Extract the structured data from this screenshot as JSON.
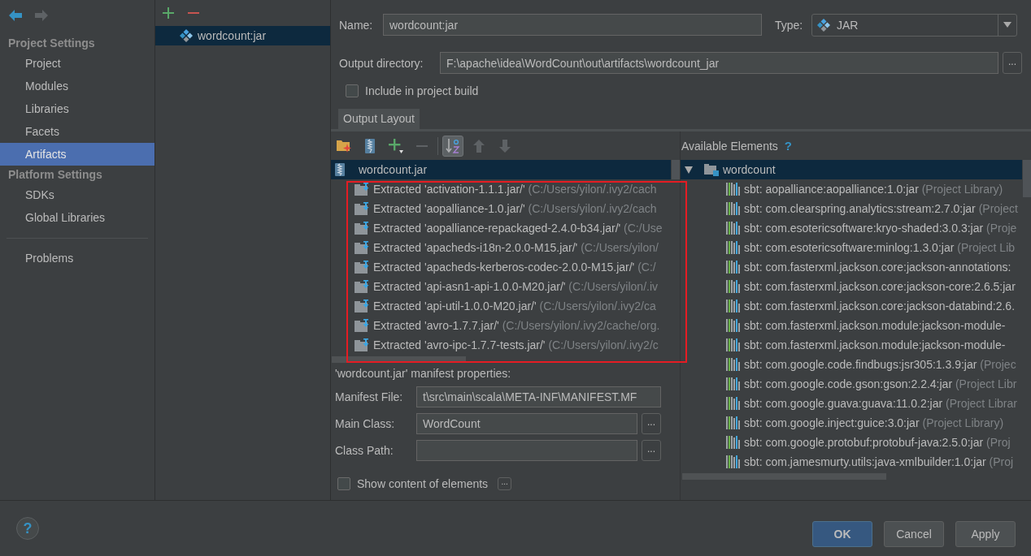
{
  "sidebar": {
    "nav": [
      {
        "kind": "back",
        "disabled": false
      },
      {
        "kind": "forward",
        "disabled": true
      }
    ],
    "sections": [
      {
        "title": "Project Settings",
        "items": [
          {
            "label": "Project",
            "selected": false
          },
          {
            "label": "Modules",
            "selected": false
          },
          {
            "label": "Libraries",
            "selected": false
          },
          {
            "label": "Facets",
            "selected": false
          },
          {
            "label": "Artifacts",
            "selected": true
          }
        ]
      },
      {
        "title": "Platform Settings",
        "items": [
          {
            "label": "SDKs",
            "selected": false
          },
          {
            "label": "Global Libraries",
            "selected": false
          }
        ]
      }
    ],
    "bottom_items": [
      {
        "label": "Problems",
        "selected": false
      }
    ]
  },
  "artifacts": {
    "toolbar": [
      {
        "kind": "add",
        "disabled": false
      },
      {
        "kind": "remove",
        "disabled": false
      }
    ],
    "items": [
      {
        "label": "wordcount:jar",
        "selected": true
      }
    ]
  },
  "form": {
    "name": {
      "label": "Name:",
      "value": "wordcount:jar"
    },
    "type": {
      "label": "Type:",
      "value": "JAR"
    },
    "output_directory": {
      "label": "Output directory:",
      "value": "F:\\apache\\idea\\WordCount\\out\\artifacts\\wordcount_jar",
      "browse": "..."
    },
    "include_in_build": {
      "label": "Include in project build",
      "checked": false
    }
  },
  "tabs": [
    {
      "label": "Output Layout",
      "selected": true
    }
  ],
  "layout_toolbar": [
    {
      "kind": "new-folder",
      "disabled": false,
      "pressed": false
    },
    {
      "kind": "archive",
      "disabled": false,
      "pressed": false
    },
    {
      "kind": "add",
      "disabled": false,
      "pressed": false
    },
    {
      "kind": "remove",
      "disabled": true,
      "pressed": false
    },
    {
      "kind": "sort",
      "disabled": false,
      "pressed": true
    },
    {
      "kind": "up",
      "disabled": true,
      "pressed": false
    },
    {
      "kind": "down",
      "disabled": true,
      "pressed": false
    }
  ],
  "output_tree": {
    "annotation_frame": true,
    "root": {
      "label": "wordcount.jar",
      "selected": true,
      "children": [
        {
          "label": "Extracted 'activation-1.1.1.jar/'",
          "hint": "(C:/Users/yilon/.ivy2/cach",
          "selected": false
        },
        {
          "label": "Extracted 'aopalliance-1.0.jar/'",
          "hint": "(C:/Users/yilon/.ivy2/cach",
          "selected": false
        },
        {
          "label": "Extracted 'aopalliance-repackaged-2.4.0-b34.jar/'",
          "hint": "(C:/Use",
          "selected": false
        },
        {
          "label": "Extracted 'apacheds-i18n-2.0.0-M15.jar/'",
          "hint": "(C:/Users/yilon/",
          "selected": false
        },
        {
          "label": "Extracted 'apacheds-kerberos-codec-2.0.0-M15.jar/'",
          "hint": "(C:/",
          "selected": false
        },
        {
          "label": "Extracted 'api-asn1-api-1.0.0-M20.jar/'",
          "hint": "(C:/Users/yilon/.iv",
          "selected": false
        },
        {
          "label": "Extracted 'api-util-1.0.0-M20.jar/'",
          "hint": "(C:/Users/yilon/.ivy2/ca",
          "selected": false
        },
        {
          "label": "Extracted 'avro-1.7.7.jar/'",
          "hint": "(C:/Users/yilon/.ivy2/cache/org.",
          "selected": false
        },
        {
          "label": "Extracted 'avro-ipc-1.7.7-tests.jar/'",
          "hint": "(C:/Users/yilon/.ivy2/c",
          "selected": false
        }
      ]
    }
  },
  "manifest": {
    "title": "'wordcount.jar' manifest properties:",
    "fields": [
      {
        "label": "Manifest File:",
        "value": "t\\src\\main\\scala\\META-INF\\MANIFEST.MF"
      },
      {
        "label": "Main Class:",
        "value": "WordCount",
        "browse": "..."
      },
      {
        "label": "Class Path:",
        "browse": "..."
      }
    ]
  },
  "show_content": {
    "label": "Show content of elements",
    "checked": false,
    "more": "..."
  },
  "available": {
    "title": "Available Elements",
    "help": "?",
    "root": {
      "label": "wordcount",
      "expanded": true,
      "selected": true,
      "children": [
        {
          "label": "sbt: aopalliance:aopalliance:1.0:jar",
          "hint": "(Project Library)",
          "selected": false
        },
        {
          "label": "sbt: com.clearspring.analytics:stream:2.7.0:jar",
          "hint": "(Project",
          "selected": false
        },
        {
          "label": "sbt: com.esotericsoftware:kryo-shaded:3.0.3:jar",
          "hint": "(Proje",
          "selected": false
        },
        {
          "label": "sbt: com.esotericsoftware:minlog:1.3.0:jar",
          "hint": "(Project Lib",
          "selected": false
        },
        {
          "label": "sbt: com.fasterxml.jackson.core:jackson-annotations:",
          "selected": false
        },
        {
          "label": "sbt: com.fasterxml.jackson.core:jackson-core:2.6.5:jar",
          "selected": false
        },
        {
          "label": "sbt: com.fasterxml.jackson.core:jackson-databind:2.6.",
          "selected": false
        },
        {
          "label": "sbt: com.fasterxml.jackson.module:jackson-module-",
          "selected": false
        },
        {
          "label": "sbt: com.fasterxml.jackson.module:jackson-module-",
          "selected": false
        },
        {
          "label": "sbt: com.google.code.findbugs:jsr305:1.3.9:jar",
          "hint": "(Projec",
          "selected": false
        },
        {
          "label": "sbt: com.google.code.gson:gson:2.2.4:jar",
          "hint": "(Project Libr",
          "selected": false
        },
        {
          "label": "sbt: com.google.guava:guava:11.0.2:jar",
          "hint": "(Project Librar",
          "selected": false
        },
        {
          "label": "sbt: com.google.inject:guice:3.0:jar",
          "hint": "(Project Library)",
          "selected": false
        },
        {
          "label": "sbt: com.google.protobuf:protobuf-java:2.5.0:jar",
          "hint": "(Proj",
          "selected": false
        },
        {
          "label": "sbt: com.jamesmurty.utils:java-xmlbuilder:1.0:jar",
          "hint": "(Proj",
          "selected": false
        }
      ]
    }
  },
  "footer": {
    "help": "?",
    "buttons": [
      {
        "label": "OK",
        "default": true
      },
      {
        "label": "Cancel",
        "default": false
      },
      {
        "label": "Apply",
        "default": false
      }
    ]
  }
}
